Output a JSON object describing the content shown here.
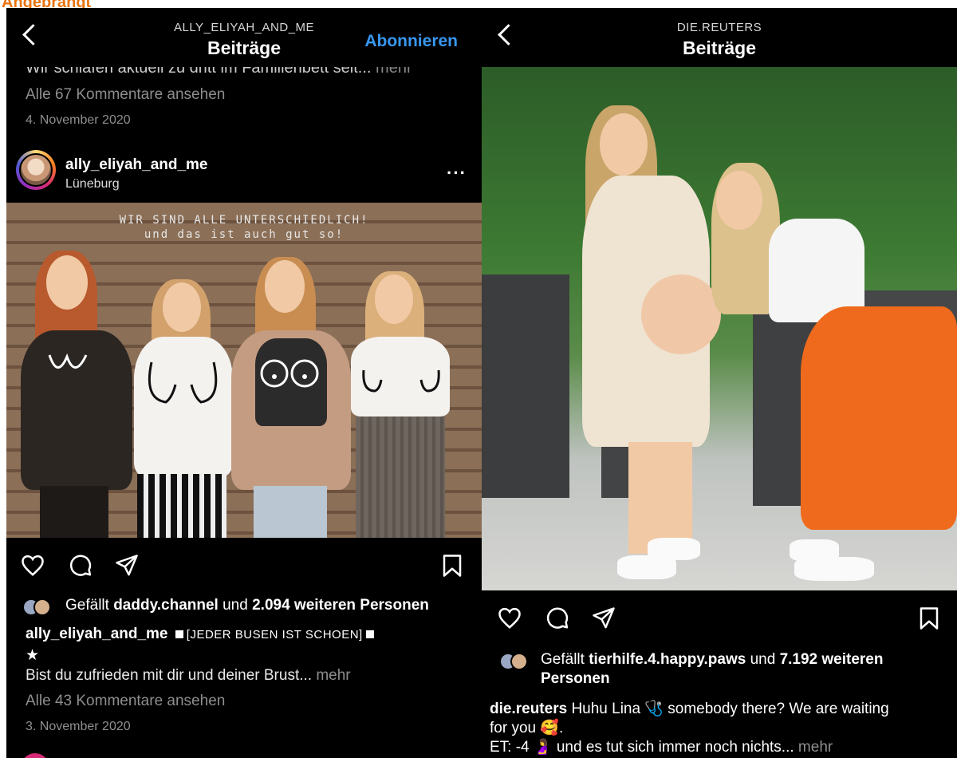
{
  "caption": "Angebrängt",
  "left": {
    "header": {
      "username": "ALLY_ELIYAH_AND_ME",
      "title": "Beiträge",
      "subscribe_label": "Abonnieren"
    },
    "prev_post": {
      "caption_cut": "Wir schlafen aktuell zu dritt im Familienbett seit...",
      "caption_more": "mehr",
      "comments": "Alle 67 Kommentare ansehen",
      "date": "4. November 2020"
    },
    "post": {
      "username": "ally_eliyah_and_me",
      "location": "Lüneburg",
      "overlay_line1": "WIR SIND ALLE UNTERSCHIEDLICH!",
      "overlay_line2": "und das ist auch gut so!",
      "likes_prefix": "Gefällt",
      "likes_user": "daddy.channel",
      "likes_mid": "und",
      "likes_count": "2.094 weiteren Personen",
      "caption_user": "ally_eliyah_and_me",
      "caption_tag": "[JEDER BUSEN IST SCHOEN]",
      "caption_star": "★",
      "caption_text": "Bist du zufrieden mit dir und deiner Brust...",
      "caption_more": "mehr",
      "comments": "Alle 43 Kommentare ansehen",
      "date": "3. November 2020"
    }
  },
  "right": {
    "header": {
      "username": "DIE.REUTERS",
      "title": "Beiträge"
    },
    "post": {
      "likes_prefix": "Gefällt",
      "likes_user": "tierhilfe.4.happy.paws",
      "likes_mid": "und",
      "likes_count": "7.192 weiteren",
      "likes_count_2": "Personen",
      "caption_user": "die.reuters",
      "caption_text_1": "Huhu Lina 🩺 somebody there? We are waiting",
      "caption_text_2": "for you 🥰.",
      "caption_text_3": "ET: -4 🤰 und es tut sich immer noch nichts...",
      "caption_more": "mehr"
    }
  },
  "colors": {
    "background": "#000000",
    "link_blue": "#3897f0",
    "muted": "#8e8e8e",
    "caption_orange": "#e8730c"
  },
  "icons": [
    "back-chevron-icon",
    "more-dots-icon",
    "heart-icon",
    "comment-icon",
    "send-icon",
    "bookmark-icon"
  ]
}
